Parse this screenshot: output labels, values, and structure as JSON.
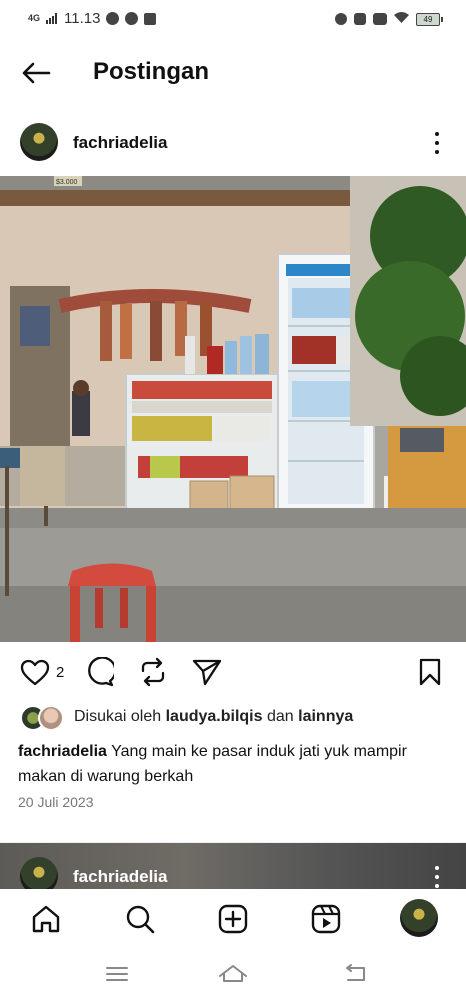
{
  "status_bar": {
    "network": "4G",
    "time": "11.13",
    "battery": "49"
  },
  "header": {
    "back_icon": "arrow-left-icon",
    "title": "Postingan"
  },
  "post": {
    "username": "fachriadelia",
    "price_tag": "$3.000",
    "likes_count": "2",
    "liked_by_prefix": "Disukai oleh",
    "liked_by_user": "laudya.bilqis",
    "liked_by_join": "dan",
    "liked_by_others": "lainnya",
    "caption_user": "fachriadelia",
    "caption_text": "Yang main ke pasar induk jati yuk mampir makan di warung berkah",
    "date": "20 Juli 2023",
    "actions": [
      "heart-icon",
      "comment-icon",
      "repost-icon",
      "share-icon",
      "bookmark-icon"
    ]
  },
  "next_post": {
    "username": "fachriadelia"
  },
  "bottom_nav": [
    "home-icon",
    "search-icon",
    "create-icon",
    "reels-icon",
    "profile-avatar"
  ],
  "system_nav": [
    "recents-icon",
    "home-icon",
    "back-icon"
  ]
}
